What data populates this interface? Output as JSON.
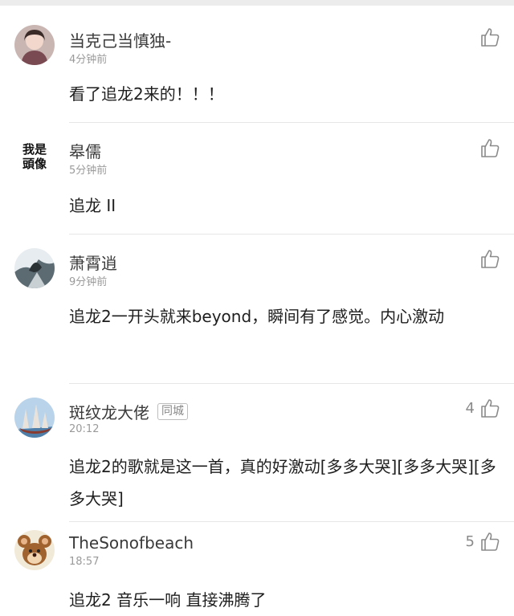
{
  "comments": [
    {
      "avatar": "avatar-girl",
      "name": "当克己当慎独-",
      "badge": "",
      "time": "4分钟前",
      "likes": "",
      "text": "看了追龙2来的！！！"
    },
    {
      "avatar": "avatar-text",
      "avatar_text": "我是頭像",
      "name": "皋儒",
      "badge": "",
      "time": "5分钟前",
      "likes": "",
      "text": "追龙 II"
    },
    {
      "avatar": "avatar-ink",
      "name": "萧霄逍",
      "badge": "",
      "time": "9分钟前",
      "likes": "",
      "text": "追龙2一开头就来beyond，瞬间有了感觉。内心激动"
    },
    {
      "avatar": "avatar-ship",
      "name": "斑纹龙大佬",
      "badge": "同城",
      "time": "20:12",
      "likes": "4",
      "text": "追龙2的歌就是这一首，真的好激动[多多大哭][多多大哭][多多大哭]"
    },
    {
      "avatar": "avatar-cartoon",
      "name": "TheSonofbeach",
      "badge": "",
      "time": "18:57",
      "likes": "5",
      "text": "追龙2 音乐一响 直接沸腾了"
    }
  ],
  "colors": {
    "name": "#3a3a3a",
    "time": "#9a9a9a",
    "text": "#1e1e1e",
    "icon": "#8a8a8a"
  },
  "icons": {
    "like": "thumbs-up-icon"
  }
}
